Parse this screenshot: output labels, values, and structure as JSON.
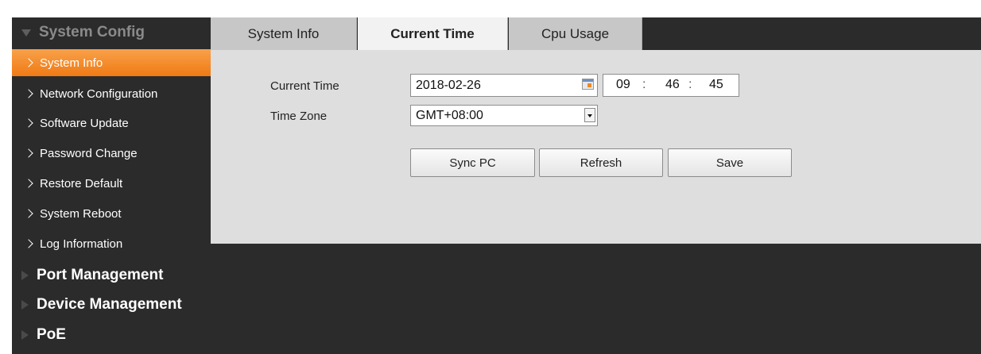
{
  "sidebar": {
    "system_config": "System Config",
    "items": [
      {
        "label": "System Info"
      },
      {
        "label": "Network Configuration"
      },
      {
        "label": "Software Update"
      },
      {
        "label": "Password Change"
      },
      {
        "label": "Restore Default"
      },
      {
        "label": "System Reboot"
      },
      {
        "label": "Log Information"
      }
    ],
    "port_management": "Port Management",
    "device_management": "Device Management",
    "poe": "PoE"
  },
  "tabs": [
    {
      "label": "System Info"
    },
    {
      "label": "Current Time"
    },
    {
      "label": "Cpu Usage"
    }
  ],
  "form": {
    "current_time_label": "Current Time",
    "date_value": "2018-02-26",
    "hour": "09",
    "minute": "46",
    "second": "45",
    "time_sep": ":",
    "time_zone_label": "Time Zone",
    "time_zone_value": "GMT+08:00"
  },
  "buttons": {
    "sync_pc": "Sync PC",
    "refresh": "Refresh",
    "save": "Save"
  },
  "colors": {
    "active_nav": "#f07a14",
    "sidebar_bg": "#2b2b2b",
    "panel_bg": "#dedede"
  }
}
